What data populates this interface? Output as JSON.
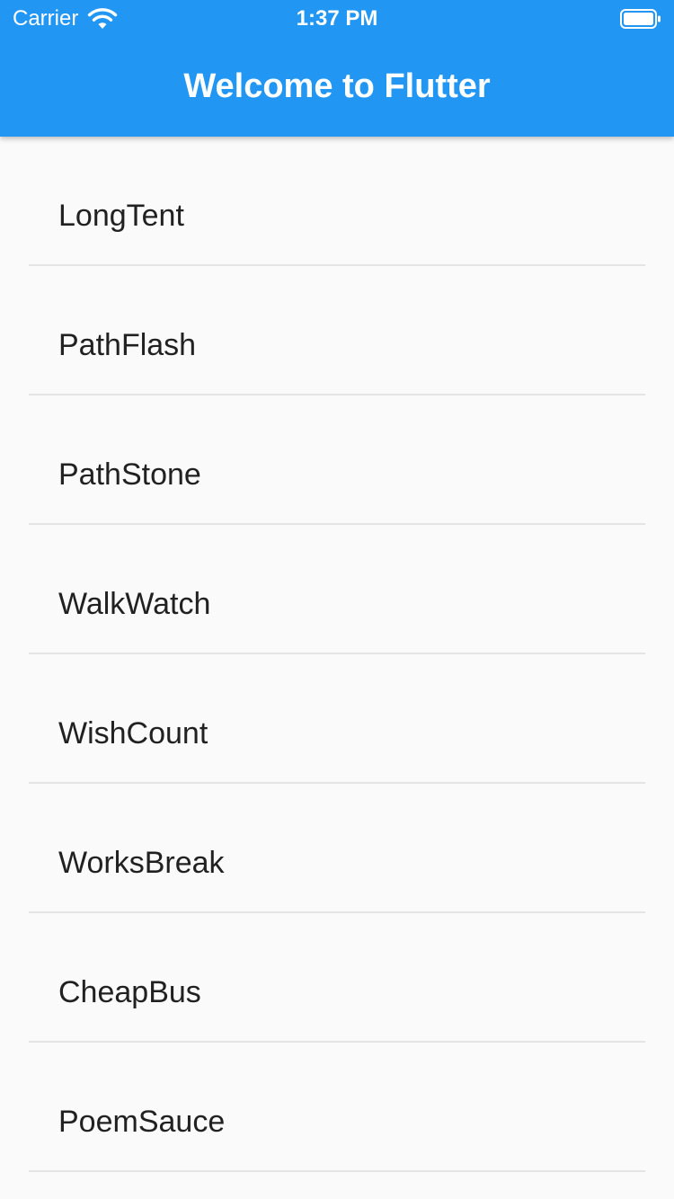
{
  "status_bar": {
    "carrier": "Carrier",
    "time": "1:37 PM",
    "wifi_icon": "wifi-icon",
    "battery_icon": "battery-icon"
  },
  "app_bar": {
    "title": "Welcome to Flutter",
    "color": "#2196f3"
  },
  "list": {
    "items": [
      {
        "label": "LongTent"
      },
      {
        "label": "PathFlash"
      },
      {
        "label": "PathStone"
      },
      {
        "label": "WalkWatch"
      },
      {
        "label": "WishCount"
      },
      {
        "label": "WorksBreak"
      },
      {
        "label": "CheapBus"
      },
      {
        "label": "PoemSauce"
      }
    ]
  }
}
